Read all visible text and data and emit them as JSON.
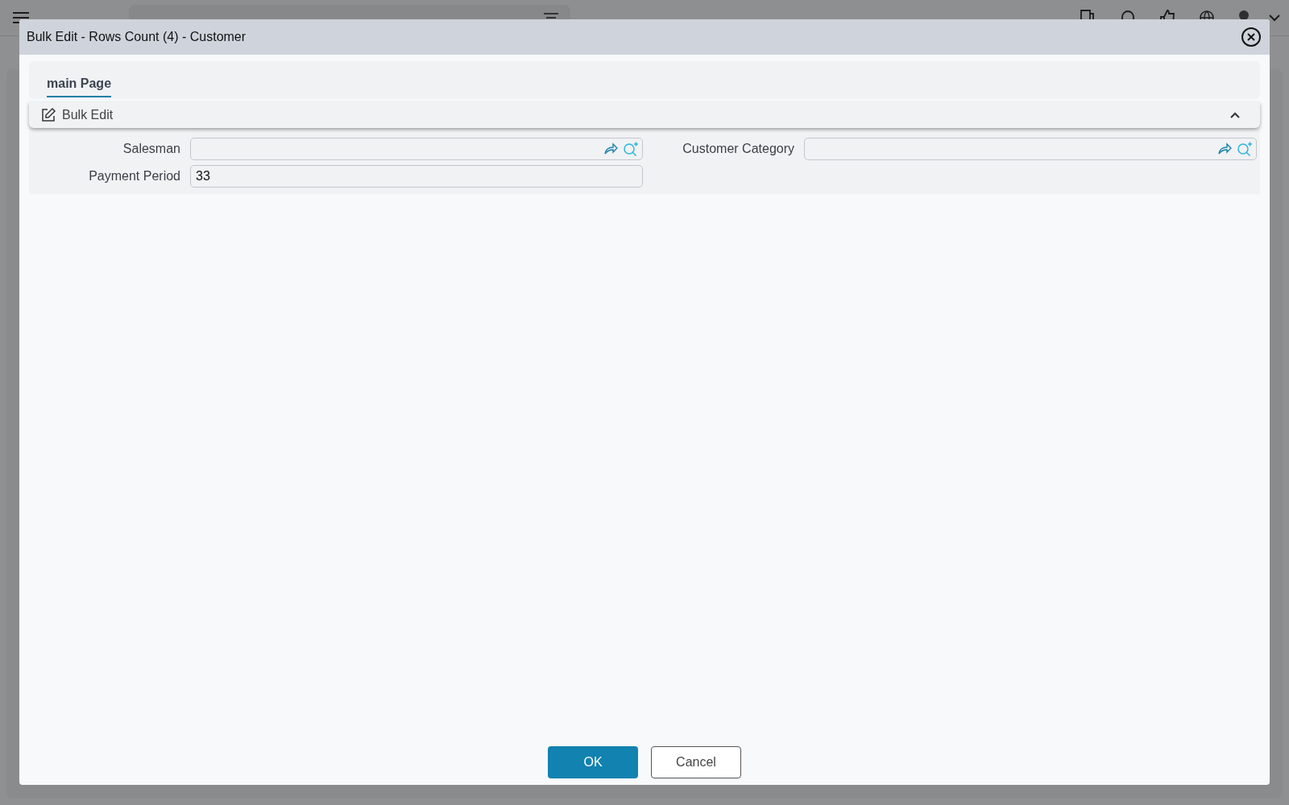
{
  "dialog": {
    "title": "Bulk Edit - Rows Count (4) - Customer",
    "tabs": [
      {
        "label": "main Page",
        "selected": true
      }
    ],
    "section": {
      "title": "Bulk Edit",
      "expanded": true
    },
    "fields": [
      {
        "label": "Salesman",
        "kind": "lookup"
      },
      {
        "label": "Customer Category",
        "kind": "lookup"
      },
      {
        "label": "Payment Period",
        "kind": "text",
        "value": "33"
      }
    ],
    "buttons": [
      {
        "label": "OK",
        "kind": "primary"
      },
      {
        "label": "Cancel",
        "kind": "secondary"
      }
    ]
  }
}
